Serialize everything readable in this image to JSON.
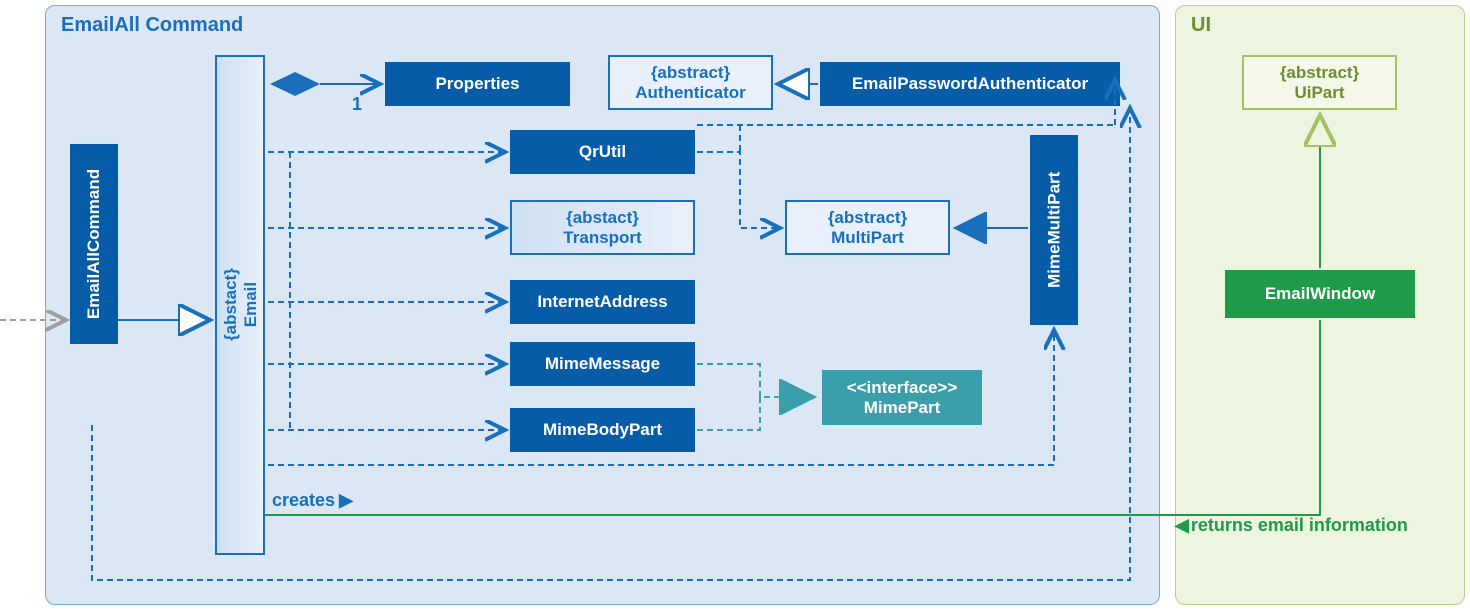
{
  "containers": {
    "emailall": "EmailAll Command",
    "ui": "UI"
  },
  "nodes": {
    "emailAllCmd": "EmailAllCommand",
    "email": {
      "stereo": "{abstact}",
      "name": "Email"
    },
    "properties": "Properties",
    "authenticator": {
      "stereo": "{abstract}",
      "name": "Authenticator"
    },
    "emailPwdAuth": "EmailPasswordAuthenticator",
    "qrutil": "QrUtil",
    "transport": {
      "stereo": "{abstact}",
      "name": "Transport"
    },
    "internetAddr": "InternetAddress",
    "mimeMessage": "MimeMessage",
    "mimeBodyPart": "MimeBodyPart",
    "multiPart": {
      "stereo": "{abstract}",
      "name": "MultiPart"
    },
    "mimeMultiPart": "MimeMultiPart",
    "mimePart": {
      "stereo": "<<interface>>",
      "name": "MimePart"
    },
    "uiPart": {
      "stereo": "{abstract}",
      "name": "UiPart"
    },
    "emailWindow": "EmailWindow"
  },
  "labels": {
    "creates": "creates",
    "returns": "returns email information",
    "mult1": "1"
  }
}
